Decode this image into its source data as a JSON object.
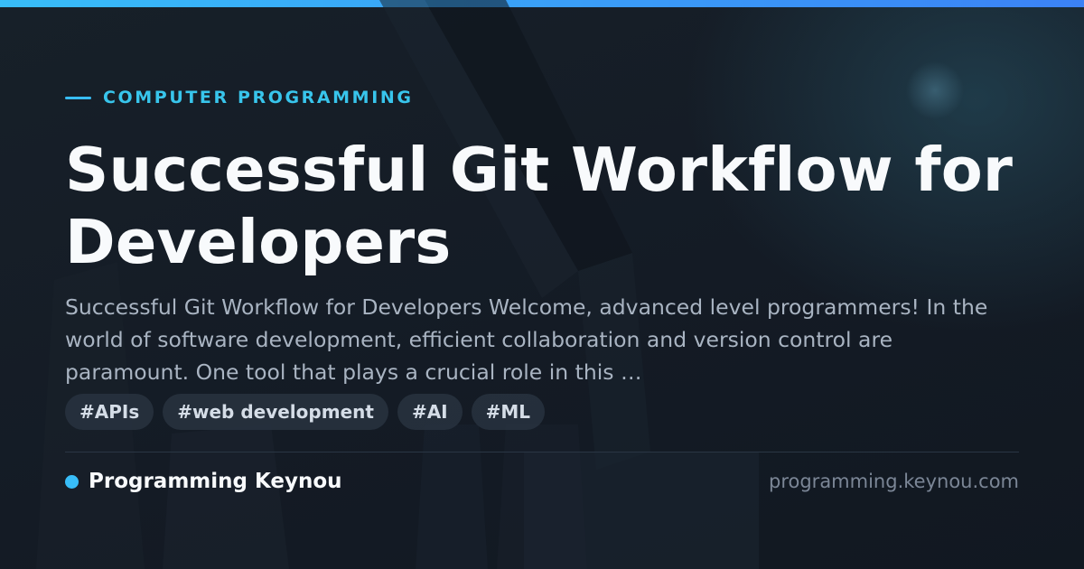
{
  "card": {
    "category": "COMPUTER PROGRAMMING",
    "title": "Successful Git Workflow for Developers",
    "excerpt": "Successful Git Workflow for Developers Welcome, advanced level programmers! In the world of software development, efficient collaboration and version control are paramount. One tool that plays a crucial role in this …",
    "tags": [
      "#APIs",
      "#web development",
      "#AI",
      "#ML"
    ],
    "site_name": "Programming Keynou",
    "domain": "programming.keynou.com"
  },
  "colors": {
    "accent": "#38bdf8",
    "accent_gradient_end": "#3b82f6",
    "background": "#131a24",
    "title": "#f8fafc",
    "excerpt": "#a9b4c2",
    "tag_background": "#283240",
    "muted": "#7b8696"
  },
  "icons": {
    "category_marker": "accent-line",
    "brand_marker": "dot-icon",
    "background_art": "code-pattern"
  }
}
